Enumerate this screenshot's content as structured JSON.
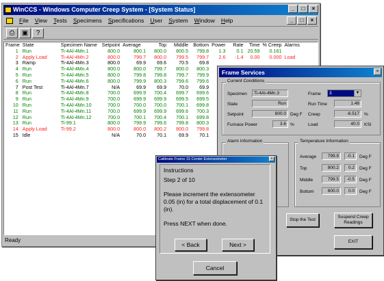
{
  "main": {
    "title": "WinCCS - Windows Computer Creep System - [System Status]",
    "menu": [
      "File",
      "View",
      "Tests",
      "Specimens",
      "Specifications",
      "User",
      "System",
      "Window",
      "Help"
    ],
    "status_bar": "Ready",
    "columns": [
      "Frame",
      "State",
      "Specimen Name",
      "Setpoint",
      "Average",
      "Top",
      "Middle",
      "Bottom",
      "Power",
      "Rate",
      "Time",
      "% Creep",
      "Alarms"
    ],
    "rows": [
      {
        "frame": "1",
        "state": "Run",
        "name": "Ti-4Al-4Mn.1",
        "setpoint": "800.0",
        "average": "800.1",
        "top": "800.0",
        "middle": "800.5",
        "bottom": "799.8",
        "power": "1.3",
        "rate": "0.1",
        "time": "20.59",
        "creep": "0.161",
        "alarms": "",
        "color": "#008000"
      },
      {
        "frame": "2",
        "state": "Apply Load",
        "name": "Ti-4Al-4Mn.2",
        "setpoint": "800.0",
        "average": "799.7",
        "top": "800.0",
        "middle": "799.5",
        "bottom": "799.7",
        "power": "2.6",
        "rate": "-1.4",
        "time": "0.00",
        "creep": "0.000",
        "alarms": "Load",
        "color": "#ff2020"
      },
      {
        "frame": "3",
        "state": "Ramp",
        "name": "Ti-4Al-4Mn.3",
        "setpoint": "800.0",
        "average": "69.9",
        "top": "69.6",
        "middle": "70.5",
        "bottom": "69.8",
        "power": "",
        "rate": "",
        "time": "",
        "creep": "",
        "alarms": "",
        "color": "#000000"
      },
      {
        "frame": "4",
        "state": "Run",
        "name": "Ti-4Al-4Mn.4",
        "setpoint": "800.0",
        "average": "800.0",
        "top": "799.7",
        "middle": "800.0",
        "bottom": "800.3",
        "power": "",
        "rate": "",
        "time": "",
        "creep": "",
        "alarms": "",
        "color": "#008000"
      },
      {
        "frame": "5",
        "state": "Run",
        "name": "Ti-4Al-4Mn.5",
        "setpoint": "800.0",
        "average": "799.8",
        "top": "799.8",
        "middle": "799.7",
        "bottom": "799.9",
        "power": "",
        "rate": "",
        "time": "",
        "creep": "",
        "alarms": "",
        "color": "#008000"
      },
      {
        "frame": "6",
        "state": "Run",
        "name": "Ti-4Al-4Mn.6",
        "setpoint": "800.0",
        "average": "799.9",
        "top": "800.3",
        "middle": "799.6",
        "bottom": "799.6",
        "power": "",
        "rate": "",
        "time": "",
        "creep": "",
        "alarms": "",
        "color": "#008000"
      },
      {
        "frame": "7",
        "state": "Post Test",
        "name": "Ti-4Al-4Mn.7",
        "setpoint": "N/A",
        "average": "69.9",
        "top": "69.9",
        "middle": "70.0",
        "bottom": "69.9",
        "power": "",
        "rate": "",
        "time": "",
        "creep": "",
        "alarms": "",
        "color": "#000000"
      },
      {
        "frame": "8",
        "state": "Run",
        "name": "Ti-4Al-4Mn.8",
        "setpoint": "700.0",
        "average": "699.9",
        "top": "700.4",
        "middle": "699.7",
        "bottom": "699.6",
        "power": "",
        "rate": "",
        "time": "",
        "creep": "",
        "alarms": "",
        "color": "#008000"
      },
      {
        "frame": "9",
        "state": "Run",
        "name": "Ti-4Al-4Mn.9",
        "setpoint": "700.0",
        "average": "699.9",
        "top": "699.9",
        "middle": "699.5",
        "bottom": "699.5",
        "power": "",
        "rate": "",
        "time": "",
        "creep": "",
        "alarms": "",
        "color": "#008000"
      },
      {
        "frame": "10",
        "state": "Run",
        "name": "Ti-4Al-4Mn.10",
        "setpoint": "700.0",
        "average": "700.0",
        "top": "700.0",
        "middle": "700.1",
        "bottom": "699.8",
        "power": "",
        "rate": "",
        "time": "",
        "creep": "",
        "alarms": "",
        "color": "#008000"
      },
      {
        "frame": "11",
        "state": "Run",
        "name": "Ti-4Al-4Mn.11",
        "setpoint": "700.0",
        "average": "699.9",
        "top": "699.9",
        "middle": "699.6",
        "bottom": "700.3",
        "power": "",
        "rate": "",
        "time": "",
        "creep": "",
        "alarms": "",
        "color": "#008000"
      },
      {
        "frame": "12",
        "state": "Run",
        "name": "Ti-4Al-4Mn.12",
        "setpoint": "700.0",
        "average": "700.1",
        "top": "700.4",
        "middle": "700.1",
        "bottom": "699.8",
        "power": "",
        "rate": "",
        "time": "",
        "creep": "",
        "alarms": "",
        "color": "#008000"
      },
      {
        "frame": "13",
        "state": "Run",
        "name": "Ti-99.1",
        "setpoint": "800.0",
        "average": "799.9",
        "top": "799.6",
        "middle": "799.8",
        "bottom": "800.3",
        "power": "",
        "rate": "",
        "time": "",
        "creep": "",
        "alarms": "",
        "color": "#008000"
      },
      {
        "frame": "14",
        "state": "Apply Load",
        "name": "Ti-99.2",
        "setpoint": "800.0",
        "average": "800.0",
        "top": "800.2",
        "middle": "800.0",
        "bottom": "799.8",
        "power": "",
        "rate": "",
        "time": "",
        "creep": "",
        "alarms": "",
        "color": "#ff2020"
      },
      {
        "frame": "15",
        "state": "Idle",
        "name": "",
        "setpoint": "N/A",
        "average": "70.0",
        "top": "70.1",
        "middle": "69.9",
        "bottom": "70.1",
        "power": "",
        "rate": "",
        "time": "",
        "creep": "",
        "alarms": "",
        "color": "#000000"
      }
    ]
  },
  "frame_services": {
    "title": "Frame Services",
    "current_conditions": {
      "group_label": "Current Conditions",
      "specimen_label": "Specimen",
      "specimen_value": "Ti-4Al-4Mn.3",
      "frame_label": "Frame",
      "frame_value": "3",
      "state_label": "State",
      "state_value": "Run",
      "run_time_label": "Run Time",
      "run_time_value": "1.48",
      "setpoint_label": "Setpoint",
      "setpoint_value": "800.0",
      "setpoint_unit": "Deg F",
      "creep_label": "Creep",
      "creep_value": "-6.517",
      "creep_unit": "%",
      "furnace_power_label": "Furnace Power",
      "furnace_power_value": "3.6",
      "furnace_power_unit": "%",
      "load_label": "Load",
      "load_value": "40.0",
      "load_unit": "KSI"
    },
    "alarm_info": {
      "group_label": "Alarm Information"
    },
    "temperature_info": {
      "group_label": "Temperature Information",
      "rows": [
        {
          "label": "Average",
          "value": "799.9",
          "delta": "-0.1",
          "unit": "Deg F"
        },
        {
          "label": "Top",
          "value": "800.2",
          "delta": "0.2",
          "unit": "Deg F"
        },
        {
          "label": "Middle",
          "value": "799.5",
          "delta": "-0.5",
          "unit": "Deg F"
        },
        {
          "label": "Bottom",
          "value": "800.0",
          "delta": "0.0",
          "unit": "Deg F"
        }
      ]
    },
    "stop_test_label": "Stop the Test",
    "suspend_label": "Suspend Creep Readings",
    "exit_label": "EXIT"
  },
  "calibrate": {
    "title": "Calibrate Frame 15 Center Extensometer",
    "heading": "Instructions",
    "step": "Step 2 of 10",
    "message": "Please increment the extensometer 0.05 (in) for a total displacement of 0.1 (in).",
    "prompt": "Press NEXT when done.",
    "back_label": "< Back",
    "next_label": "Next >",
    "cancel_label": "Cancel"
  }
}
